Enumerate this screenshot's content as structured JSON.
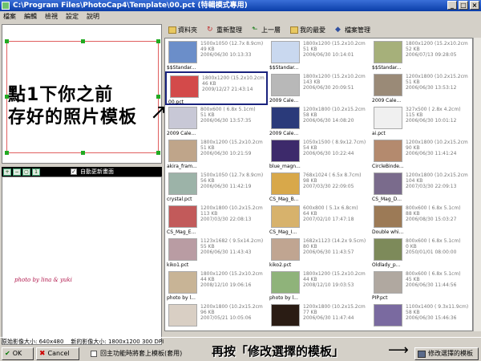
{
  "window": {
    "title": "C:\\Program Files\\PhotoCap4\\Template\\00.pct (特輯模式專用)"
  },
  "menu": [
    "檔案",
    "編輯",
    "檢視",
    "設定",
    "說明"
  ],
  "toolbar": {
    "folder": "資料夾",
    "refresh": "重新整理",
    "up": "上一層",
    "favorites": "我的最愛",
    "manage": "檔案管理"
  },
  "left": {
    "auto_update": "自動更新畫面",
    "credit": "photo by lina & yuki"
  },
  "annotations": {
    "left_line1": "點1下你之前",
    "left_line2": "存好的照片模板",
    "bottom": "再按「修改選擇的模板」"
  },
  "files": [
    {
      "res": "1500x1050 (12.7x 8.9cm)",
      "size": "49 KB",
      "date": "2006/06/30 10:13:33",
      "name": "$$Standar...",
      "color": "#6b8ec9"
    },
    {
      "res": "1800x1200 (15.2x10.2cm",
      "size": "51 KB",
      "date": "2006/06/30 10:14:01",
      "name": "$$Standar...",
      "color": "#c9d8ef"
    },
    {
      "res": "1800x1200 (15.2x10.2cm",
      "size": "52 KB",
      "date": "2006/07/13 09:28:05",
      "name": "$$Standar...",
      "color": "#a6b07a"
    },
    {
      "res": "1800x1200 (15.2x10.2cm",
      "size": "46 KB",
      "date": "2009/12/27 21:43:14",
      "name": "00.pct",
      "color": "#d34a4a",
      "selected": true
    },
    {
      "res": "1800x1200 (15.2x10.2cm",
      "size": "143 KB",
      "date": "2006/06/30 20:09:51",
      "name": "2009 Cale...",
      "color": "#b8b8b8"
    },
    {
      "res": "1200x1800 (10.2x15.2cm",
      "size": "51 KB",
      "date": "2006/06/30 13:53:12",
      "name": "2009 Cale...",
      "color": "#9a8a77"
    },
    {
      "res": "800x600 ( 6.8x 5.1cm)",
      "size": "51 KB",
      "date": "2006/06/30 13:57:35",
      "name": "2009 Cale...",
      "color": "#c8c8d6"
    },
    {
      "res": "1200x1800 (10.2x15.2cm",
      "size": "58 KB",
      "date": "2006/06/30 14:08:20",
      "name": "2009 Cale...",
      "color": "#2a3a7a"
    },
    {
      "res": "327x500 ( 2.8x 4.2cm)",
      "size": "115 KB",
      "date": "2006/06/30 10:01:12",
      "name": "ai.pct",
      "color": "#f0f0f0"
    },
    {
      "res": "1800x1200 (15.2x10.2cm",
      "size": "51 KB",
      "date": "2006/06/30 10:21:59",
      "name": "akira_fram...",
      "color": "#bfa58a"
    },
    {
      "res": "1050x1500 ( 8.9x12.7cm)",
      "size": "54 KB",
      "date": "2006/06/30 10:22:44",
      "name": "blue_magn...",
      "color": "#3d2a6b"
    },
    {
      "res": "1200x1800 (10.2x15.2cm",
      "size": "90 KB",
      "date": "2006/06/30 11:41:24",
      "name": "CircleBinde...",
      "color": "#b48a6e"
    },
    {
      "res": "1500x1050 (12.7x 8.9cm)",
      "size": "56 KB",
      "date": "2006/06/30 11:42:19",
      "name": "crystal.pct",
      "color": "#9cb3a8"
    },
    {
      "res": "768x1024 ( 6.5x 8.7cm)",
      "size": "98 KB",
      "date": "2007/03/30 22:09:05",
      "name": "CS_Mag_B...",
      "color": "#d8a84a"
    },
    {
      "res": "1200x1800 (10.2x15.2cm",
      "size": "104 KB",
      "date": "2007/03/30 22:09:13",
      "name": "CS_Mag_D...",
      "color": "#7a6b8c"
    },
    {
      "res": "1200x1800 (10.2x15.2cm",
      "size": "113 KB",
      "date": "2007/03/30 22:08:13",
      "name": "CS_Mag_E...",
      "color": "#c25a5a"
    },
    {
      "res": "600x800 ( 5.1x 6.8cm)",
      "size": "64 KB",
      "date": "2007/02/10 17:47:18",
      "name": "CS_Mag_I...",
      "color": "#d7b26c"
    },
    {
      "res": "800x600 ( 6.8x 5.1cm)",
      "size": "88 KB",
      "date": "2006/08/30 15:03:27",
      "name": "Double whi...",
      "color": "#9c7a56"
    },
    {
      "res": "1123x1682 ( 9.5x14.2cm)",
      "size": "55 KB",
      "date": "2006/06/30 11:43:43",
      "name": "kiko1.pct",
      "color": "#b99ca3"
    },
    {
      "res": "1682x1123 (14.2x 9.5cm)",
      "size": "80 KB",
      "date": "2006/06/30 11:43:57",
      "name": "kiko2.pct",
      "color": "#c0a591"
    },
    {
      "res": "800x600 ( 6.8x 5.1cm)",
      "size": "0 KB",
      "date": "2050/01/01 08:00:00",
      "name": "Oldlady_p...",
      "color": "#7d8a5a"
    },
    {
      "res": "1800x1200 (15.2x10.2cm",
      "size": "44 KB",
      "date": "2008/12/10 19:06:16",
      "name": "photo by l...",
      "color": "#c8b496"
    },
    {
      "res": "1800x1200 (15.2x10.2cm",
      "size": "44 KB",
      "date": "2008/12/10 19:03:53",
      "name": "photo by l...",
      "color": "#8fb37a"
    },
    {
      "res": "800x600 ( 6.8x 5.1cm)",
      "size": "45 KB",
      "date": "2006/06/30 11:44:56",
      "name": "PIP.pct",
      "color": "#b0a8a0"
    },
    {
      "res": "1200x1800 (10.2x15.2cm",
      "size": "96 KB",
      "date": "2007/05/21 10:05:06",
      "name": "",
      "color": "#d9cfc4"
    },
    {
      "res": "1200x1800 (10.2x15.2cm",
      "size": "77 KB",
      "date": "2006/06/30 11:47:44",
      "name": "",
      "color": "#2a1c14"
    },
    {
      "res": "1100x1400 ( 9.3x11.9cm)",
      "size": "58 KB",
      "date": "2006/06/30 15:46:36",
      "name": "",
      "color": "#7a6aa0"
    }
  ],
  "status": {
    "original": "原始影像大小: 640x480",
    "new": "新的影像大小: 1800x1200 300 DPI"
  },
  "bottom": {
    "ok": "OK",
    "cancel": "Cancel",
    "checkbox_label": "回主功能時將套上模板(套用)",
    "modify": "修改選擇的模板"
  }
}
